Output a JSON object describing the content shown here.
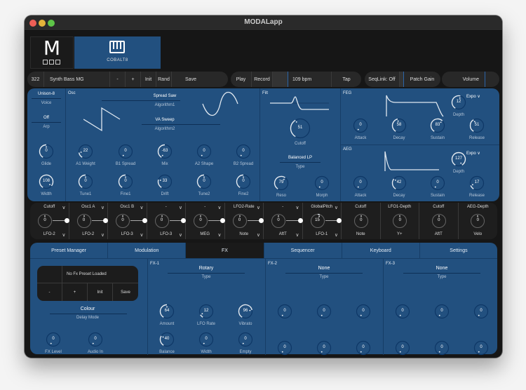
{
  "window": {
    "title": "MODALapp",
    "traffic_lights": [
      "close",
      "minimize",
      "zoom"
    ]
  },
  "device_tabs": {
    "logo_letter": "M",
    "device_name": "COBALT8"
  },
  "toolbar": {
    "preset_number": "322",
    "preset_name": "Synth Bass MG",
    "minus": "-",
    "plus": "+",
    "init": "Init",
    "rand": "Rand",
    "save": "Save",
    "play": "Play",
    "record": "Record",
    "bpm": "109 bpm",
    "tap": "Tap",
    "seqlink": "SeqLink: Off",
    "patch_gain": "Patch Gain",
    "volume": "Volume"
  },
  "voice": {
    "unison": "Unison-8",
    "voice_label": "Voice",
    "arp_value": "Off",
    "arp_label": "Arp",
    "glide": {
      "label": "Glide",
      "value": "0",
      "fraction": 0.5
    },
    "width": {
      "label": "Width",
      "value": "108",
      "fraction": 0.93
    }
  },
  "osc": {
    "title": "Osc",
    "algo1_value": "Spread Saw",
    "algo1_label": "Algorithm1",
    "algo2_value": "VA Sweep",
    "algo2_label": "Algorithm2",
    "knobs_row1": [
      {
        "label": "A1 Weight",
        "value": "22",
        "fraction": 0.17
      },
      {
        "label": "B1 Spread",
        "value": "0",
        "fraction": 0.0
      },
      {
        "label": "Mix",
        "value": "-63",
        "fraction": 0.5,
        "bipolar": -0.5
      },
      {
        "label": "A2 Shape",
        "value": "0",
        "fraction": 0.0
      },
      {
        "label": "B2 Spread",
        "value": "0",
        "fraction": 0.0
      }
    ],
    "knobs_row2": [
      {
        "label": "Tune1",
        "value": "0",
        "fraction": 0.5
      },
      {
        "label": "Fine1",
        "value": "0",
        "fraction": 0.5
      },
      {
        "label": "Drift",
        "value": "33",
        "fraction": 0.26
      },
      {
        "label": "Tune2",
        "value": "0",
        "fraction": 0.5
      },
      {
        "label": "Fine2",
        "value": "0",
        "fraction": 0.5
      }
    ]
  },
  "filter": {
    "title": "Filt",
    "cutoff": {
      "label": "Cutoff",
      "value": "51",
      "fraction": 0.4
    },
    "type_value": "Balanced LP",
    "type_label": "Type",
    "reso": {
      "label": "Reso",
      "value": "79",
      "fraction": 0.62
    },
    "morph": {
      "label": "Morph",
      "value": "0",
      "fraction": 0.0
    }
  },
  "feg": {
    "title": "FEG",
    "curve": "Expo",
    "depth": {
      "label": "Depth",
      "value": "12",
      "fraction": 0.55
    },
    "knobs": [
      {
        "label": "Attack",
        "value": "0",
        "fraction": 0.0
      },
      {
        "label": "Decay",
        "value": "58",
        "fraction": 0.46
      },
      {
        "label": "Sustain",
        "value": "83",
        "fraction": 0.65
      },
      {
        "label": "Release",
        "value": "51",
        "fraction": 0.4
      }
    ]
  },
  "aeg": {
    "title": "AEG",
    "curve": "Expo",
    "depth": {
      "label": "Depth",
      "value": "127",
      "fraction": 1.0
    },
    "knobs": [
      {
        "label": "Attack",
        "value": "0",
        "fraction": 0.0
      },
      {
        "label": "Decay",
        "value": "42",
        "fraction": 0.33
      },
      {
        "label": "Sustain",
        "value": "0",
        "fraction": 0.0
      },
      {
        "label": "Release",
        "value": "17",
        "fraction": 0.13
      }
    ]
  },
  "mod_slots": [
    {
      "dest": "Cutoff",
      "value": "0",
      "source": "LFO-2",
      "linked": true
    },
    {
      "dest": "Osc1 A",
      "value": "0",
      "source": "LFO-2",
      "linked": true
    },
    {
      "dest": "Osc1 B",
      "value": "0",
      "source": "LFO-3",
      "linked": true
    },
    {
      "dest": "-",
      "value": "0",
      "source": "LFO-3",
      "linked": true
    },
    {
      "dest": "-",
      "value": "0",
      "source": "MEG",
      "linked": true
    },
    {
      "dest": "LFO2-Rate",
      "value": "0",
      "source": "Note",
      "linked": true
    },
    {
      "dest": "-",
      "value": "0",
      "source": "AftT",
      "linked": true
    },
    {
      "dest": "GlobalPitch",
      "value": "15",
      "source": "LFO-1",
      "linked": true
    },
    {
      "dest": "Cutoff",
      "value": "0",
      "source": "Note",
      "linked": false
    },
    {
      "dest": "LFO1-Depth",
      "value": "0",
      "source": "Y+",
      "linked": false
    },
    {
      "dest": "Cutoff",
      "value": "0",
      "source": "AftT",
      "linked": false
    },
    {
      "dest": "AEG-Depth",
      "value": "0",
      "source": "Velo",
      "linked": false
    }
  ],
  "tabs": [
    {
      "label": "Preset Manager",
      "active": false
    },
    {
      "label": "Modulation",
      "active": false
    },
    {
      "label": "FX",
      "active": true
    },
    {
      "label": "Sequencer",
      "active": false
    },
    {
      "label": "Keyboard",
      "active": false
    },
    {
      "label": "Settings",
      "active": false
    }
  ],
  "fx_preset": {
    "status": "No Fx Preset Loaded",
    "minus": "-",
    "plus": "+",
    "init": "Init",
    "save": "Save",
    "delay_mode_value": "Colour",
    "delay_mode_label": "Delay Mode",
    "knobs": [
      {
        "label": "FX Level",
        "value": "0",
        "fraction": 0.0
      },
      {
        "label": "Audio In",
        "value": "0",
        "fraction": 0.0
      }
    ]
  },
  "fx1": {
    "title": "FX-1",
    "type_value": "Rotary",
    "type_label": "Type",
    "knobs": [
      {
        "label": "Amount",
        "value": "64",
        "fraction": 0.5
      },
      {
        "label": "LFO Rate",
        "value": "12",
        "fraction": 0.1
      },
      {
        "label": "Vibrato",
        "value": "96",
        "fraction": 0.76
      },
      {
        "label": "Balance",
        "value": "40",
        "fraction": 0.31
      },
      {
        "label": "Width",
        "value": "0",
        "fraction": 0.0
      },
      {
        "label": "Empty",
        "value": "0",
        "fraction": 0.0
      }
    ]
  },
  "fx2": {
    "title": "FX-2",
    "type_value": "None",
    "type_label": "Type",
    "knobs": [
      {
        "label": "",
        "value": "0",
        "fraction": 0.0
      },
      {
        "label": "",
        "value": "0",
        "fraction": 0.0
      },
      {
        "label": "",
        "value": "0",
        "fraction": 0.0
      },
      {
        "label": "",
        "value": "0",
        "fraction": 0.0
      },
      {
        "label": "",
        "value": "0",
        "fraction": 0.0
      },
      {
        "label": "",
        "value": "0",
        "fraction": 0.0
      }
    ]
  },
  "fx3": {
    "title": "FX-3",
    "type_value": "None",
    "type_label": "Type",
    "knobs": [
      {
        "label": "",
        "value": "0",
        "fraction": 0.0
      },
      {
        "label": "",
        "value": "0",
        "fraction": 0.0
      },
      {
        "label": "",
        "value": "0",
        "fraction": 0.0
      },
      {
        "label": "",
        "value": "0",
        "fraction": 0.0
      },
      {
        "label": "",
        "value": "0",
        "fraction": 0.0
      },
      {
        "label": "",
        "value": "0",
        "fraction": 0.0
      }
    ]
  },
  "colors": {
    "panel_blue": "#22507f",
    "dark_bg": "#161616",
    "knob_track": "#0e3766",
    "knob_arc": "#e6ecf2",
    "accent_line": "#2b64a8"
  }
}
